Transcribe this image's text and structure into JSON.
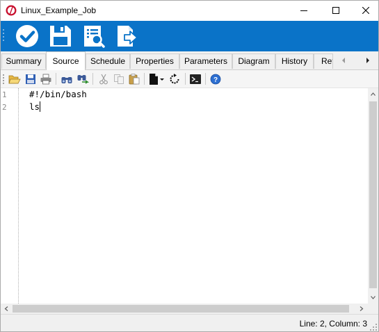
{
  "window": {
    "title": "Linux_Example_Job",
    "icon": "app-logo-icon",
    "controls": [
      "minimize-icon",
      "maximize-icon",
      "close-icon"
    ]
  },
  "main_toolbar": {
    "buttons": [
      "save-and-close-icon",
      "save-icon",
      "view-report-icon",
      "export-icon"
    ],
    "background_color": "#0a73c8"
  },
  "tabs": [
    {
      "label": "Summary"
    },
    {
      "label": "Source",
      "active": true
    },
    {
      "label": "Schedule"
    },
    {
      "label": "Properties"
    },
    {
      "label": "Parameters"
    },
    {
      "label": "Diagram"
    },
    {
      "label": "History"
    },
    {
      "label": "Ref"
    }
  ],
  "editor_toolbar": {
    "buttons": [
      "open-icon",
      "save-icon",
      "print-icon",
      "find-icon",
      "find-replace-icon",
      "cut-icon",
      "copy-icon",
      "paste-icon",
      "new-document-icon",
      "refresh-icon",
      "terminal-icon",
      "help-icon"
    ]
  },
  "editor": {
    "line_numbers": [
      "1",
      "2"
    ],
    "lines": [
      "#!/bin/bash",
      "ls"
    ]
  },
  "status": {
    "position": "Line: 2, Column: 3"
  }
}
